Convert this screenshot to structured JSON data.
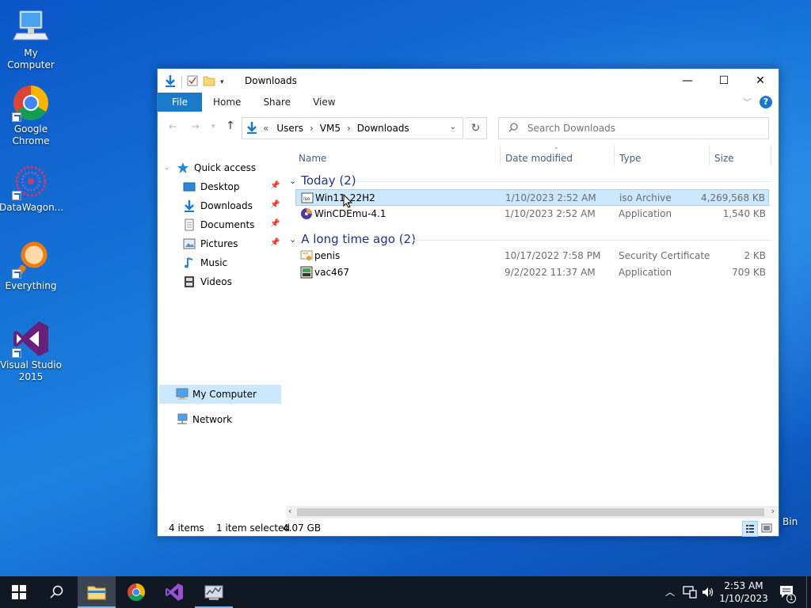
{
  "desktop": {
    "icons": [
      {
        "label": "My Computer"
      },
      {
        "label": "Google Chrome"
      },
      {
        "label": "DataWagon..."
      },
      {
        "label": "Everything"
      },
      {
        "label": "Visual Studio 2015"
      }
    ],
    "recycle_bin_partial_label": "Bin"
  },
  "window": {
    "title": "Downloads",
    "controls": {
      "minimize": "—",
      "maximize": "☐",
      "close": "✕"
    },
    "ribbon_tabs": [
      "File",
      "Home",
      "Share",
      "View"
    ],
    "help": "?",
    "address": {
      "prefix": "«",
      "crumbs": [
        "Users",
        "VM5",
        "Downloads"
      ],
      "separator": "›"
    },
    "search": {
      "placeholder": "Search Downloads"
    },
    "nav": {
      "quick_access": "Quick access",
      "items": [
        {
          "label": "Desktop",
          "pinned": true
        },
        {
          "label": "Downloads",
          "pinned": true
        },
        {
          "label": "Documents",
          "pinned": true
        },
        {
          "label": "Pictures",
          "pinned": true
        },
        {
          "label": "Music",
          "pinned": false
        },
        {
          "label": "Videos",
          "pinned": false
        }
      ],
      "my_computer": "My Computer",
      "network": "Network"
    },
    "columns": {
      "name": "Name",
      "date": "Date modified",
      "type": "Type",
      "size": "Size"
    },
    "groups": [
      {
        "title": "Today (2)",
        "files": [
          {
            "name": "Win11_22H2",
            "date": "1/10/2023 2:52 AM",
            "type": "iso Archive",
            "size": "4,269,568 KB",
            "selected": true
          },
          {
            "name": "WinCDEmu-4.1",
            "date": "1/10/2023 2:52 AM",
            "type": "Application",
            "size": "1,540 KB",
            "selected": false
          }
        ]
      },
      {
        "title": "A long time ago (2)",
        "files": [
          {
            "name": "penis",
            "date": "10/17/2022 7:58 PM",
            "type": "Security Certificate",
            "size": "2 KB",
            "selected": false
          },
          {
            "name": "vac467",
            "date": "9/2/2022 11:37 AM",
            "type": "Application",
            "size": "709 KB",
            "selected": false
          }
        ]
      }
    ],
    "status": {
      "items": "4 items",
      "selected": "1 item selected",
      "size": "4.07 GB"
    }
  },
  "taskbar": {
    "clock_time": "2:53 AM",
    "clock_date": "1/10/2023",
    "notification_count": "1"
  },
  "colors": {
    "accent": "#1979ca",
    "selection": "#cce8ff",
    "group_title": "#1e3287"
  }
}
